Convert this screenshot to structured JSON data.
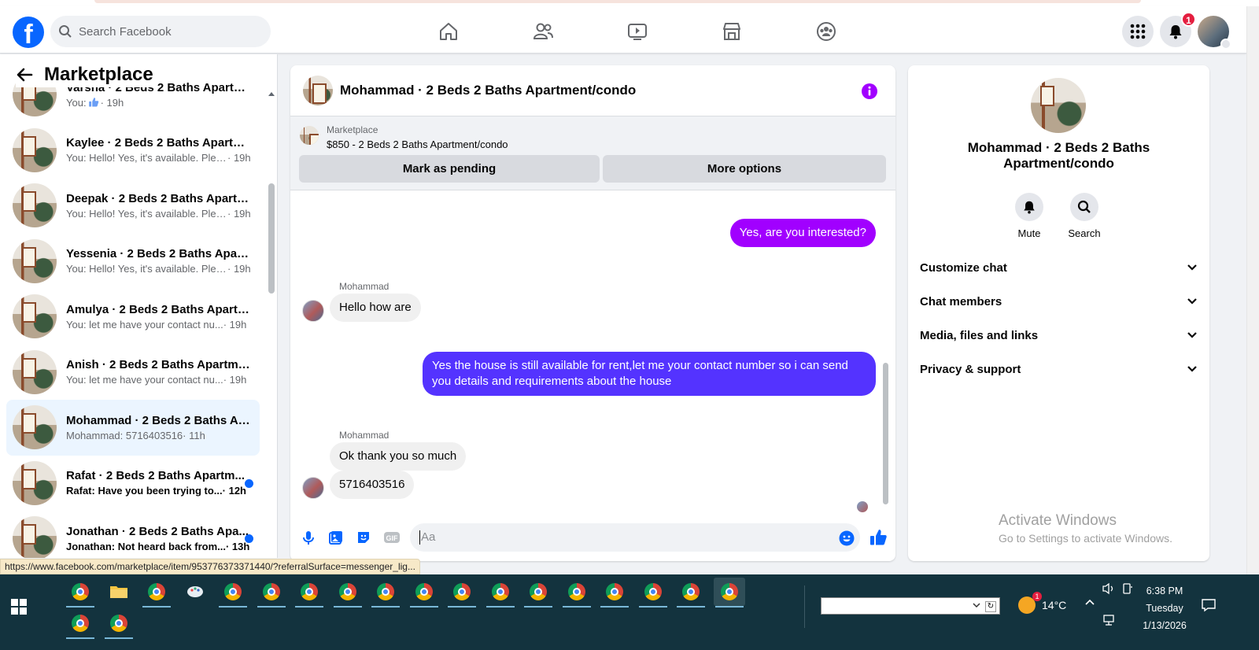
{
  "topbar": {
    "logo": "f",
    "search_placeholder": "Search Facebook",
    "nav_icons": [
      "home-icon",
      "friends-icon",
      "watch-icon",
      "marketplace-icon",
      "groups-icon"
    ],
    "notification_count": "1"
  },
  "left": {
    "title": "Marketplace",
    "conversations": [
      {
        "name": "Varsha · 2 Beds 2 Baths Apartme...",
        "preview": "You: ",
        "time": "· 19h",
        "has_like": true
      },
      {
        "name": "Kaylee · 2 Beds 2 Baths Apartme...",
        "preview": "You: Hello! Yes, it's available. Pleas...",
        "time": "· 19h"
      },
      {
        "name": "Deepak · 2 Beds 2 Baths Apartm...",
        "preview": "You: Hello! Yes, it's available. Pleas...",
        "time": "· 19h"
      },
      {
        "name": "Yessenia · 2 Beds 2 Baths Apart...",
        "preview": "You: Hello! Yes, it's available. Pleas...",
        "time": "· 19h"
      },
      {
        "name": "Amulya · 2 Beds 2 Baths Apartm...",
        "preview": "You: let me have your contact nu...",
        "time": "· 19h"
      },
      {
        "name": "Anish · 2 Beds 2 Baths Apartme...",
        "preview": "You: let me have your contact nu...",
        "time": "· 19h"
      },
      {
        "name": "Mohammad · 2 Beds 2 Baths Ap...",
        "preview": "Mohammad: 5716403516",
        "time": " · 11h",
        "active": true
      },
      {
        "name": "Rafat · 2 Beds 2 Baths Apartm...",
        "preview": "Rafat: Have you been trying to...",
        "time": " · 12h",
        "unread": true
      },
      {
        "name": "Jonathan · 2 Beds 2 Baths Apa...",
        "preview": "Jonathan: Not heard back from...",
        "time": " · 13h",
        "unread": true
      }
    ]
  },
  "chat": {
    "title": "Mohammad · 2 Beds 2 Baths Apartment/condo",
    "marketplace_label": "Marketplace",
    "listing": "$850 - 2 Beds 2 Baths Apartment/condo",
    "mark_pending": "Mark as pending",
    "more_options": "More options",
    "messages": [
      {
        "from": "me",
        "text": "Yes, are you interested?"
      },
      {
        "from": "Mohammad",
        "sender": "Mohammad",
        "text": "Hello how are"
      },
      {
        "from": "me",
        "text": "Yes the house is still available for rent,let me your contact number so i can send you details and requirements about the house"
      },
      {
        "from": "Mohammad",
        "sender": "Mohammad",
        "text": "Ok thank you so much"
      },
      {
        "from": "Mohammad",
        "text": "5716403516"
      }
    ],
    "input_placeholder": "Aa"
  },
  "info": {
    "name": "Mohammad · 2 Beds 2 Baths Apartment/condo",
    "mute": "Mute",
    "search": "Search",
    "sections": [
      "Customize chat",
      "Chat members",
      "Media, files and links",
      "Privacy & support"
    ]
  },
  "watermark": {
    "line1": "Activate Windows",
    "line2": "Go to Settings to activate Windows."
  },
  "status_url": "https://www.facebook.com/marketplace/item/953776373371440/?referralSurface=messenger_lig...",
  "taskbar": {
    "temperature": "14°C",
    "time": "6:38 PM",
    "day": "Tuesday",
    "date": "1/13/2026",
    "weather_badge": "1"
  },
  "colors": {
    "outgoing_bubble": "#a100ff",
    "outgoing_bubble_2": "#5433ff",
    "facebook_blue": "#0866ff"
  }
}
